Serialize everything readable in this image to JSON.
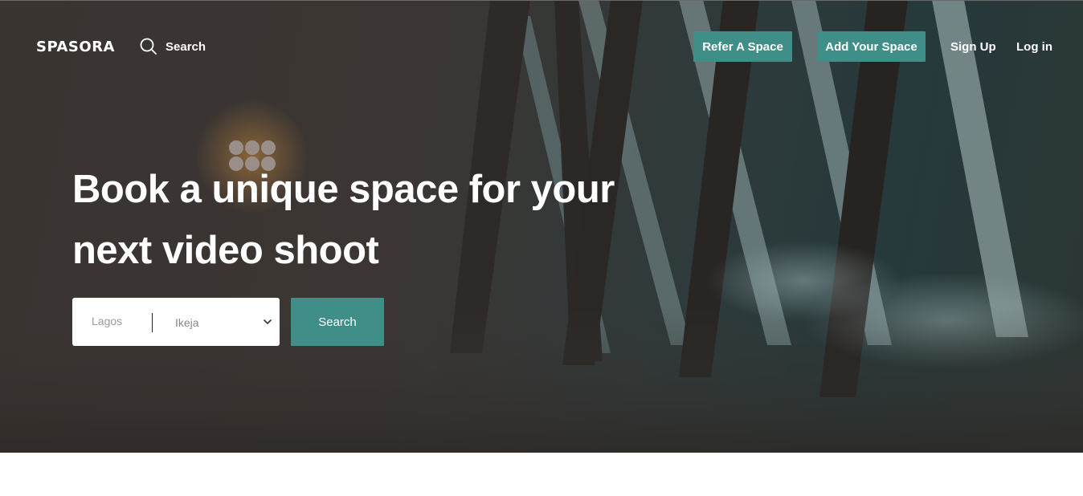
{
  "brand": {
    "logo_text": "SPASORA"
  },
  "nav": {
    "search_label": "Search",
    "refer_label": "Refer A Space",
    "add_label": "Add Your Space",
    "signup_label": "Sign Up",
    "login_label": "Log in"
  },
  "hero": {
    "headline": "Book a unique space for your next video shoot",
    "city_placeholder": "Lagos",
    "area_selected": "Ikeja",
    "search_button": "Search"
  },
  "colors": {
    "accent": "#3f8f88",
    "hero_overlay": "#3a3431"
  },
  "icons": [
    "search-icon",
    "chevron-down-icon"
  ]
}
